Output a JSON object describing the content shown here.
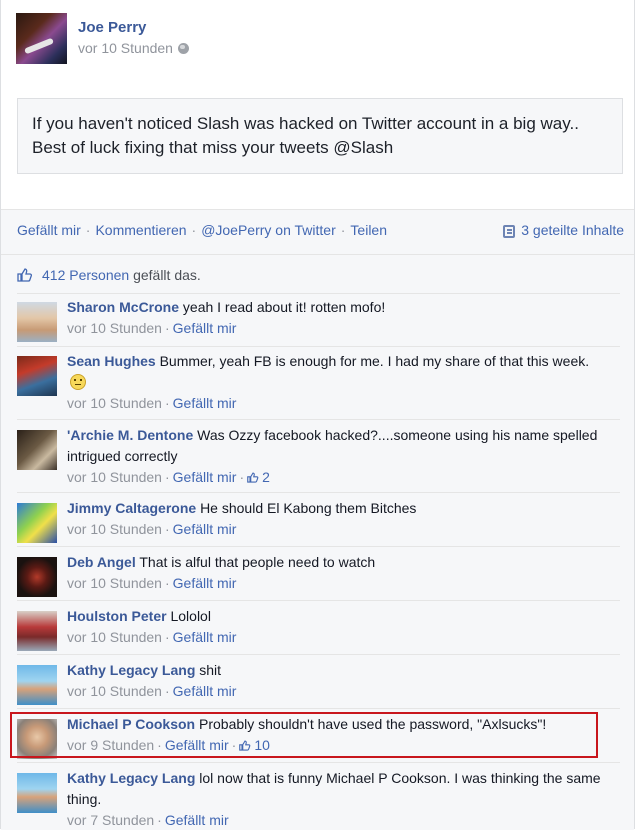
{
  "post": {
    "author": "Joe Perry",
    "time": "vor 10 Stunden",
    "text": "If you haven't noticed Slash was hacked on Twitter account in a big way.. Best of luck fixing that miss your tweets @Slash"
  },
  "actions": {
    "like": "Gefällt mir",
    "comment": "Kommentieren",
    "twitter": "@JoePerry on Twitter",
    "share": "Teilen",
    "shared_count": "3 geteilte Inhalte"
  },
  "likes": {
    "count_text": "412 Personen",
    "suffix": "gefällt das."
  },
  "comments": [
    {
      "name": "Sharon McCrone",
      "text": "yeah I read about it! rotten mofo!",
      "time": "vor 10 Stunden",
      "like": "Gefällt mir",
      "likes": ""
    },
    {
      "name": "Sean Hughes",
      "text": "Bummer, yeah FB is enough for me. I had my share of that this week.",
      "time": "vor 10 Stunden",
      "like": "Gefällt mir",
      "likes": ""
    },
    {
      "name": "'Archie M. Dentone",
      "text": "Was Ozzy facebook hacked?....someone using his name spelled intrigued correctly",
      "time": "vor 10 Stunden",
      "like": "Gefällt mir",
      "likes": "2"
    },
    {
      "name": "Jimmy Caltagerone",
      "text": "He should El Kabong them Bitches",
      "time": "vor 10 Stunden",
      "like": "Gefällt mir",
      "likes": ""
    },
    {
      "name": "Deb Angel",
      "text": "That is alful that people need to watch",
      "time": "vor 10 Stunden",
      "like": "Gefällt mir",
      "likes": ""
    },
    {
      "name": "Houlston Peter",
      "text": "Lololol",
      "time": "vor 10 Stunden",
      "like": "Gefällt mir",
      "likes": ""
    },
    {
      "name": "Kathy Legacy Lang",
      "text": "shit",
      "time": "vor 10 Stunden",
      "like": "Gefällt mir",
      "likes": ""
    },
    {
      "name": "Michael P Cookson",
      "text": "Probably shouldn't have used the password, \"Axlsucks\"!",
      "time": "vor 9 Stunden",
      "like": "Gefällt mir",
      "likes": "10"
    },
    {
      "name": "Kathy Legacy Lang",
      "text": "lol now that is funny Michael P Cookson. I was thinking the same thing.",
      "time": "vor 7 Stunden",
      "like": "Gefällt mir",
      "likes": ""
    }
  ],
  "colors": {
    "link": "#3b5998",
    "meta": "#90949c",
    "highlight_border": "#c8161d",
    "comments_bg": "#f6f7f9"
  }
}
